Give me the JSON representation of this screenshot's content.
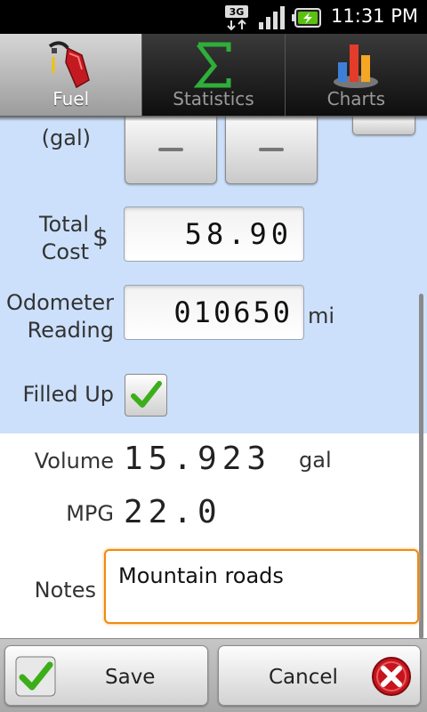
{
  "status_bar": {
    "network": "3G",
    "time": "11:31 PM"
  },
  "tabs": [
    {
      "label": "Fuel",
      "icon": "fuel-pump-icon",
      "active": true
    },
    {
      "label": "Statistics",
      "icon": "sigma-icon",
      "active": false
    },
    {
      "label": "Charts",
      "icon": "bar-chart-icon",
      "active": false
    }
  ],
  "form": {
    "volume_unit_label": "(gal)",
    "total_cost_label_1": "Total",
    "total_cost_label_2": "Cost",
    "currency": "$",
    "total_cost_value": "58.90",
    "odometer_label_1": "Odometer",
    "odometer_label_2": "Reading",
    "odometer_value": "010650",
    "odometer_unit": "mi",
    "filled_up_label": "Filled Up",
    "filled_up_checked": true
  },
  "results": {
    "volume_label": "Volume",
    "volume_value": "15.923",
    "volume_unit": "gal",
    "mpg_label": "MPG",
    "mpg_value": "22.0",
    "notes_label": "Notes",
    "notes_value": "Mountain roads"
  },
  "buttons": {
    "save_label": "Save",
    "cancel_label": "Cancel"
  },
  "colors": {
    "form_background": "#cce0fb",
    "notes_focus": "#f08a14",
    "check_green": "#3cae19",
    "cancel_red": "#c7141c"
  }
}
